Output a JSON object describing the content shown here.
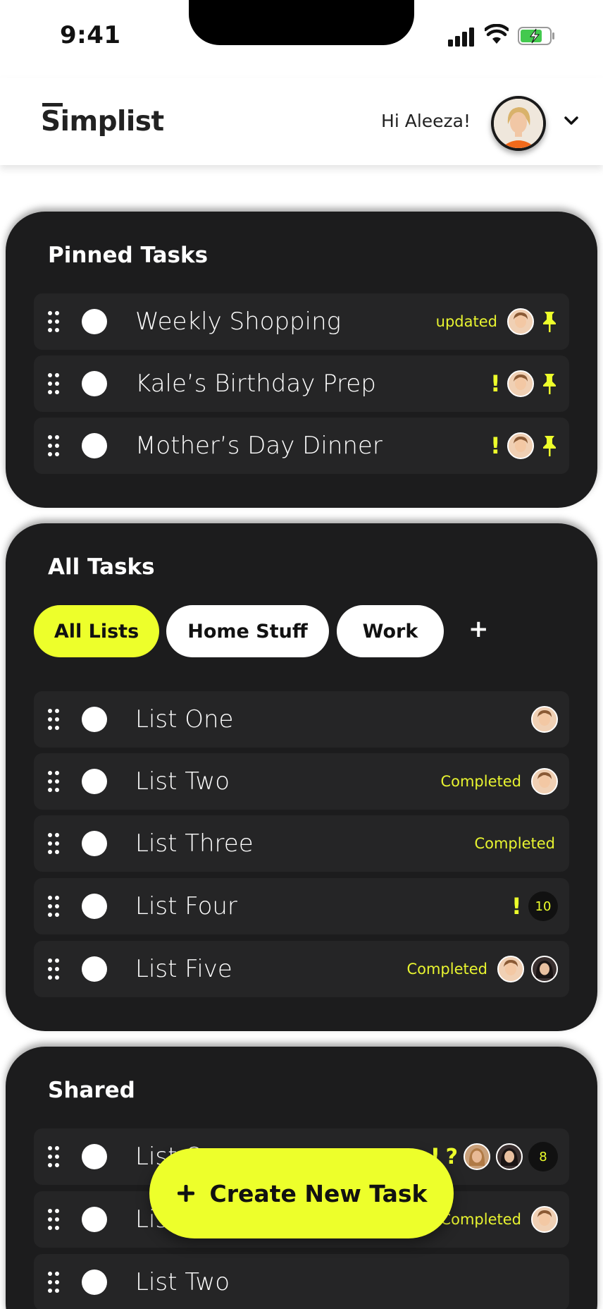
{
  "status_bar": {
    "time": "9:41"
  },
  "header": {
    "logo": "Simplist",
    "greeting": "Hi Aleeza!"
  },
  "pinned": {
    "title": "Pinned Tasks",
    "items": [
      {
        "label": "Weekly Shopping",
        "status": "updated"
      },
      {
        "label": "Kale’s Birthday Prep",
        "status": "!"
      },
      {
        "label": "Mother’s Day Dinner",
        "status": "!"
      }
    ]
  },
  "all_tasks": {
    "title": "All Tasks",
    "filters": [
      "All Lists",
      "Home Stuff",
      "Work"
    ],
    "add_filter": "+",
    "items": [
      {
        "label": "List One",
        "status": ""
      },
      {
        "label": "List Two",
        "status": "Completed"
      },
      {
        "label": "List Three",
        "status": "Completed"
      },
      {
        "label": "List Four",
        "status": "!",
        "count": "10"
      },
      {
        "label": "List Five",
        "status": "Completed"
      }
    ]
  },
  "shared": {
    "title": "Shared",
    "items": [
      {
        "label": "List One",
        "flags": [
          "!",
          "?"
        ],
        "count": "8"
      },
      {
        "label": "List One",
        "status": "Completed"
      },
      {
        "label": "List Two",
        "status": ""
      }
    ]
  },
  "fab": {
    "icon": "plus-icon",
    "label": "Create New Task"
  },
  "colors": {
    "accent": "#EDFF2B",
    "card": "#1C1C1D",
    "row": "#252526"
  }
}
